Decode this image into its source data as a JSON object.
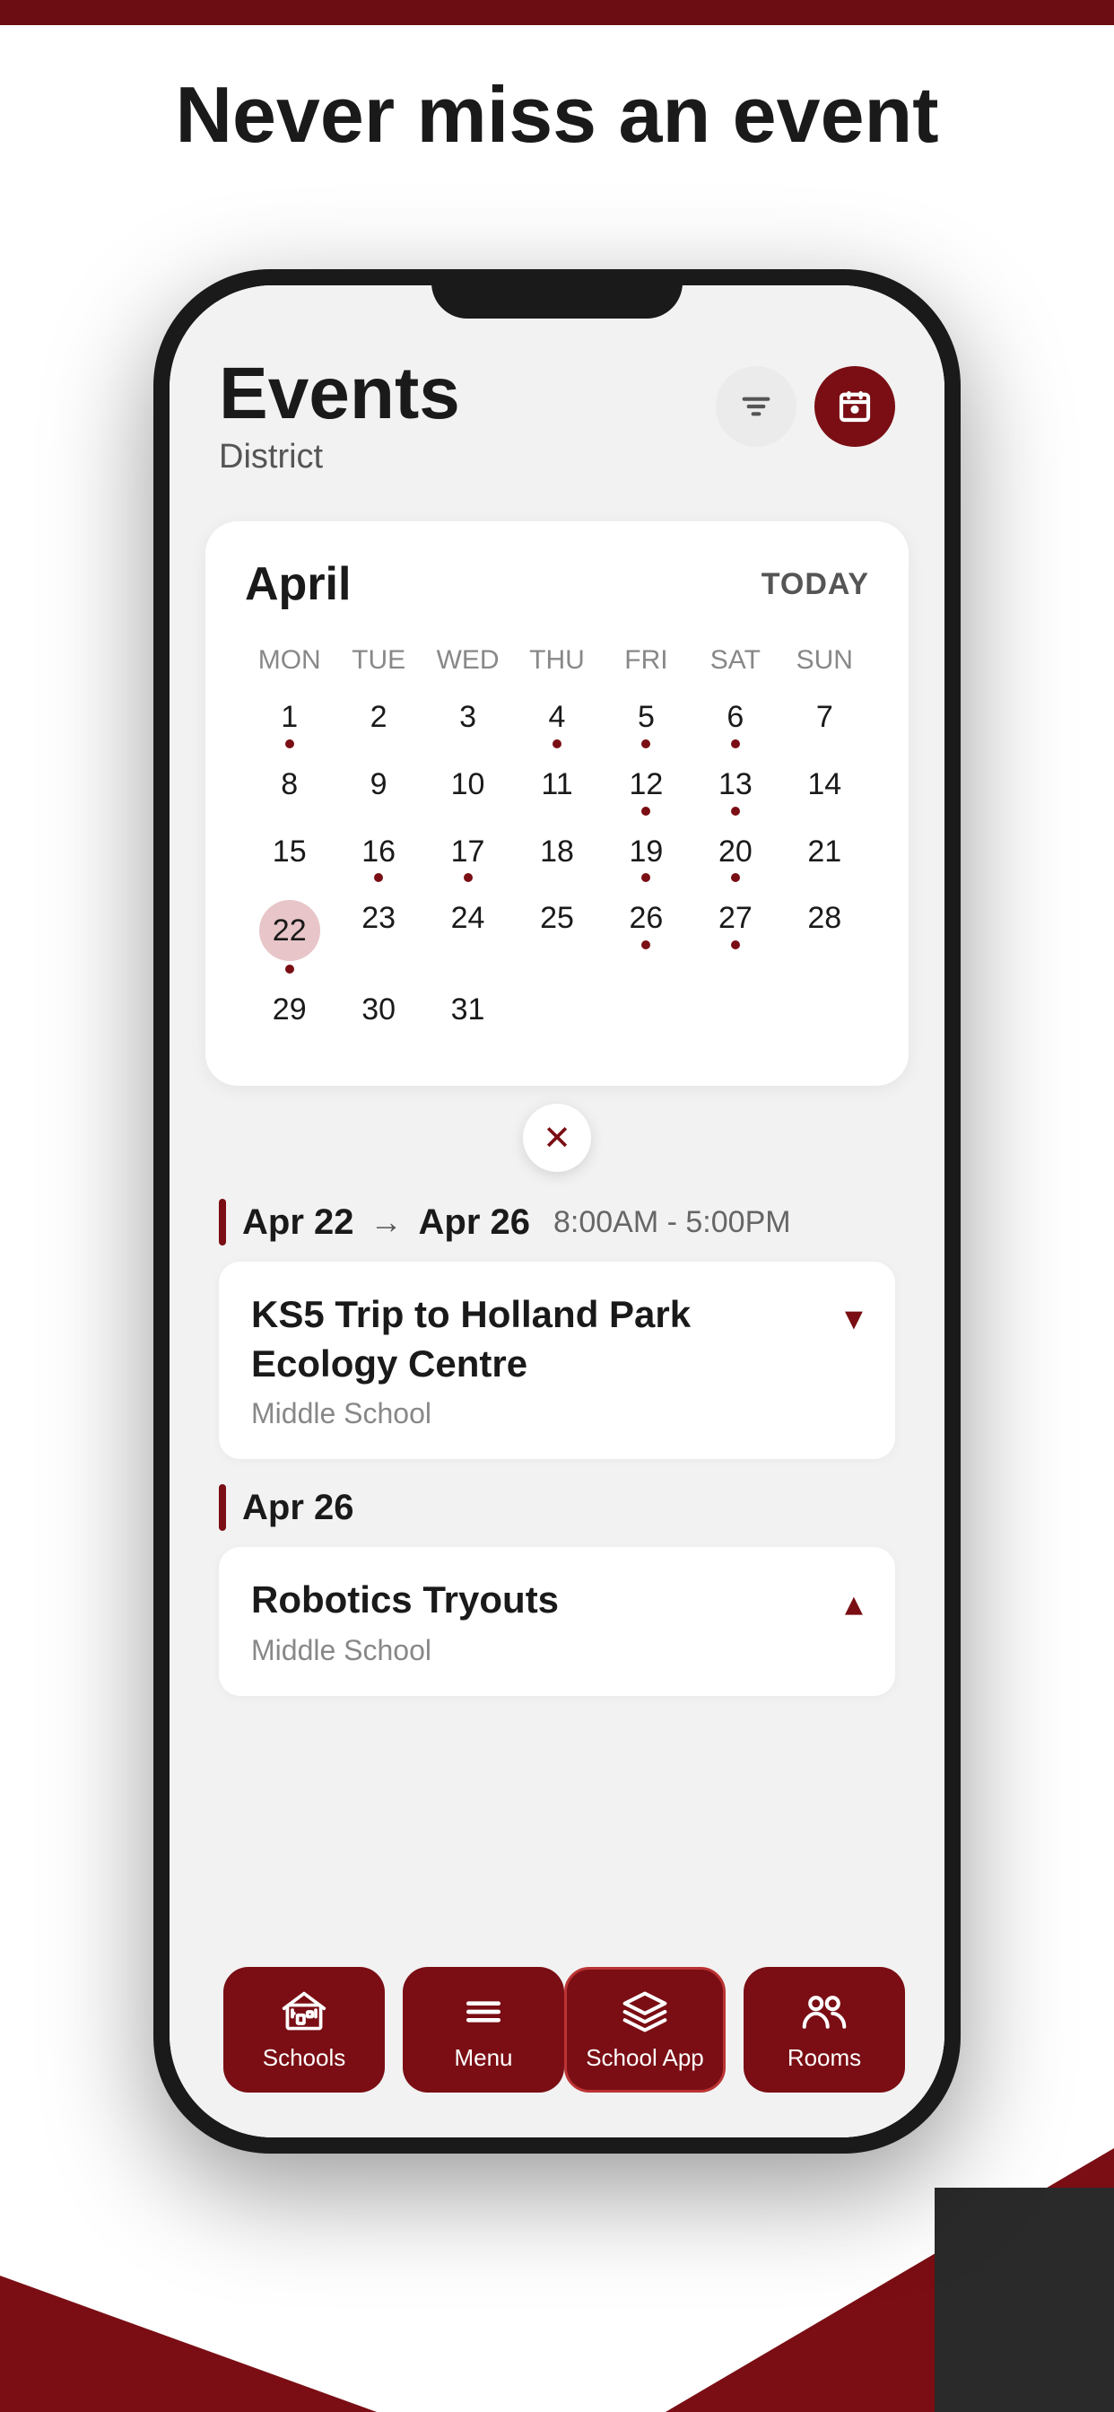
{
  "page": {
    "headline": "Never miss an event",
    "top_bar_color": "#6b0d12",
    "brand_color": "#7a0e14"
  },
  "app_header": {
    "title": "Events",
    "subtitle": "District",
    "btn_filter_label": "Filter",
    "btn_calendar_label": "Calendar"
  },
  "calendar": {
    "month": "April",
    "today_btn": "TODAY",
    "day_headers": [
      "MON",
      "TUE",
      "WED",
      "THU",
      "FRI",
      "SAT",
      "SUN"
    ],
    "weeks": [
      [
        {
          "num": "1",
          "dot": true
        },
        {
          "num": "2",
          "dot": false
        },
        {
          "num": "3",
          "dot": false
        },
        {
          "num": "4",
          "dot": true
        },
        {
          "num": "5",
          "dot": true
        },
        {
          "num": "6",
          "dot": true
        },
        {
          "num": "7",
          "dot": false
        }
      ],
      [
        {
          "num": "8",
          "dot": false
        },
        {
          "num": "9",
          "dot": false
        },
        {
          "num": "10",
          "dot": false
        },
        {
          "num": "11",
          "dot": false
        },
        {
          "num": "12",
          "dot": true
        },
        {
          "num": "13",
          "dot": true
        },
        {
          "num": "14",
          "dot": false
        }
      ],
      [
        {
          "num": "15",
          "dot": false
        },
        {
          "num": "16",
          "dot": true
        },
        {
          "num": "17",
          "dot": true
        },
        {
          "num": "18",
          "dot": false
        },
        {
          "num": "19",
          "dot": true
        },
        {
          "num": "20",
          "dot": true
        },
        {
          "num": "21",
          "dot": false
        }
      ],
      [
        {
          "num": "22",
          "dot": true,
          "selected": true
        },
        {
          "num": "23",
          "dot": false
        },
        {
          "num": "24",
          "dot": false
        },
        {
          "num": "25",
          "dot": false
        },
        {
          "num": "26",
          "dot": true
        },
        {
          "num": "27",
          "dot": true
        },
        {
          "num": "28",
          "dot": false
        }
      ],
      [
        {
          "num": "29",
          "dot": false
        },
        {
          "num": "30",
          "dot": false
        },
        {
          "num": "31",
          "dot": false
        },
        {
          "num": "",
          "dot": false
        },
        {
          "num": "",
          "dot": false
        },
        {
          "num": "",
          "dot": false
        },
        {
          "num": "",
          "dot": false
        }
      ]
    ]
  },
  "events": [
    {
      "date_start": "Apr 22",
      "date_end": "Apr 26",
      "time": "8:00AM - 5:00PM",
      "title": "KS5 Trip to Holland Park Ecology Centre",
      "school": "Middle School",
      "expanded": false,
      "chevron": "▾"
    },
    {
      "date_start": "Apr 26",
      "date_end": null,
      "time": null,
      "title": "Robotics Tryouts",
      "school": "Middle School",
      "expanded": true,
      "chevron": "▴"
    }
  ],
  "bottom_nav": {
    "items": [
      {
        "id": "schools",
        "label": "Schools",
        "active": false
      },
      {
        "id": "menu",
        "label": "Menu",
        "active": false
      },
      {
        "id": "school_app",
        "label": "School App",
        "active": true
      },
      {
        "id": "rooms",
        "label": "Rooms",
        "active": false
      }
    ]
  }
}
